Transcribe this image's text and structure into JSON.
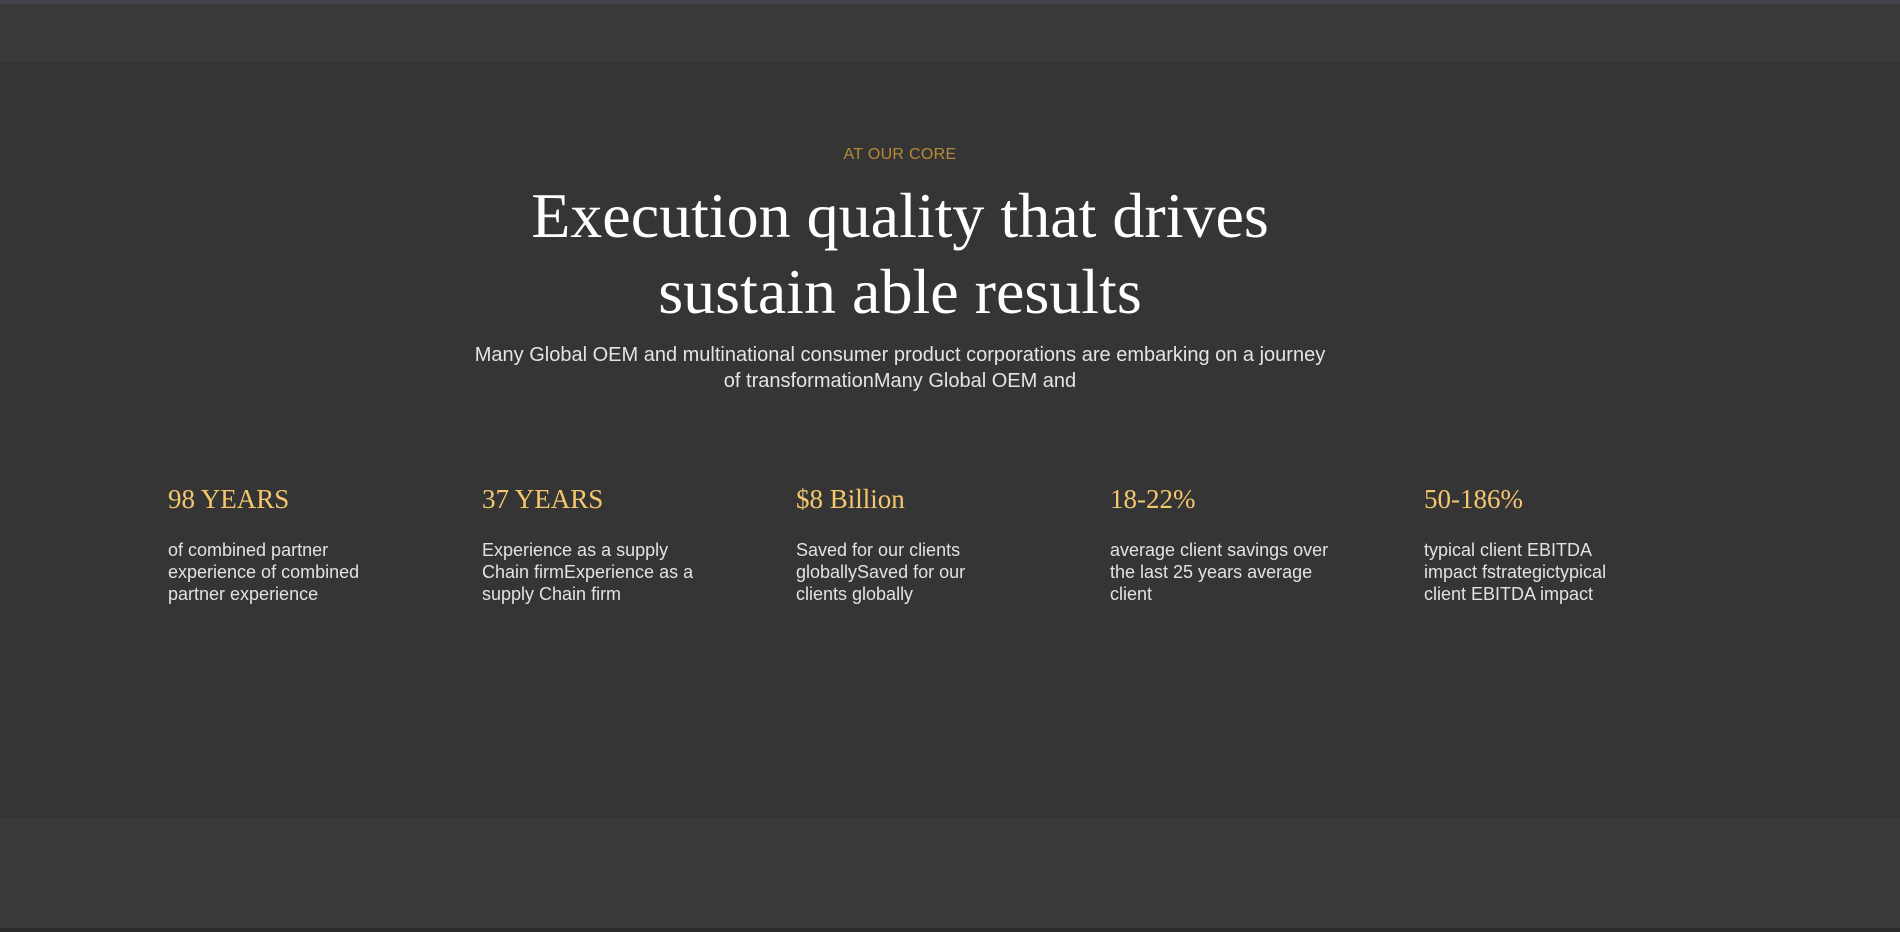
{
  "section": {
    "eyebrow": "AT OUR CORE",
    "headline": "Execution quality that drives sustain able results",
    "intro": "Many Global OEM and multinational consumer product corporations are embarking on a journey of transformationMany Global OEM and",
    "accent_color": "#b88a35",
    "value_color": "#f5c76d"
  },
  "stats": [
    {
      "value": "98 YEARS",
      "description": "of combined partner experience of combined partner experience"
    },
    {
      "value": "37 YEARS",
      "description": "Experience as a supply Chain firmExperience as a supply Chain firm"
    },
    {
      "value": "$8 Billion",
      "description": "Saved for our clients globallySaved for our clients globally"
    },
    {
      "value": "18-22%",
      "description": "average client savings over the last 25 years average client"
    },
    {
      "value": "50-186%",
      "description": "typical client EBITDA impact fstrategictypical client EBITDA impact"
    }
  ]
}
